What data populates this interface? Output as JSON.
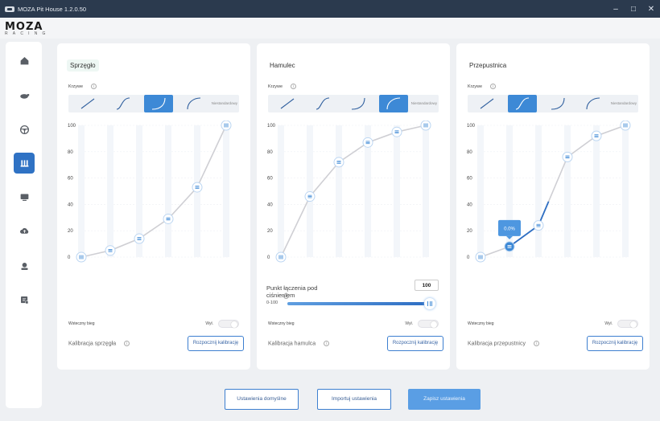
{
  "window": {
    "title": "MOZA Pit House 1.2.0.50",
    "controls": [
      "–",
      "□",
      "✕"
    ]
  },
  "logo": {
    "main": "MOZA",
    "sub": "RACING"
  },
  "sidebar": {
    "items": [
      {
        "name": "home",
        "icon": "home-icon",
        "active": false
      },
      {
        "name": "wheelbase",
        "icon": "wheelbase-icon",
        "active": false
      },
      {
        "name": "steering-wheel",
        "icon": "steering-wheel-icon",
        "active": false
      },
      {
        "name": "pedals",
        "icon": "pedals-icon",
        "active": true
      },
      {
        "name": "dashboard",
        "icon": "monitor-icon",
        "active": false
      },
      {
        "name": "cloud",
        "icon": "cloud-upload-icon",
        "active": false
      },
      {
        "name": "user",
        "icon": "user-icon",
        "active": false
      },
      {
        "name": "feedback",
        "icon": "feedback-icon",
        "active": false
      }
    ]
  },
  "common": {
    "curve_label": "Krzywe",
    "custom_label": "Niestandardowy",
    "reverse_label": "Wsteczny bieg",
    "toggle_state": "Wył.",
    "y_ticks": [
      "0",
      "20",
      "40",
      "60",
      "80",
      "100"
    ]
  },
  "panels": [
    {
      "id": "clutch",
      "title": "Sprzęgło",
      "active_preset": 2,
      "calibration_label": "Kalibracja sprzęgła",
      "calibration_button": "Rozpocznij kalibrację",
      "curve_points": [
        0,
        5,
        14,
        29,
        53,
        100
      ]
    },
    {
      "id": "brake",
      "title": "Hamulec",
      "active_preset": 3,
      "calibration_label": "Kalibracja hamulca",
      "calibration_button": "Rozpocznij kalibrację",
      "curve_points": [
        0,
        46,
        72,
        87,
        95,
        100
      ],
      "breakpoint": {
        "label": "Punkt łączenia pod ciśnieniem",
        "range": "0-100",
        "value": "100"
      }
    },
    {
      "id": "throttle",
      "title": "Przepustnica",
      "active_preset": 1,
      "calibration_label": "Kalibracja przepustnicy",
      "calibration_button": "Rozpocznij kalibrację",
      "curve_points": [
        0,
        8,
        24,
        76,
        92,
        100
      ],
      "tooltip": "0.0%"
    }
  ],
  "footer": {
    "defaults_button": "Ustawienia domyślne",
    "import_button": "Importuj ustawienia",
    "save_button": "Zapisz ustawienia"
  },
  "colors": {
    "accent": "#3d89d6",
    "active_nav": "#2f72c4",
    "titlebar": "#2b3a4e",
    "curve": "#cfcfd4",
    "curve_active": "#2f6fc3"
  }
}
